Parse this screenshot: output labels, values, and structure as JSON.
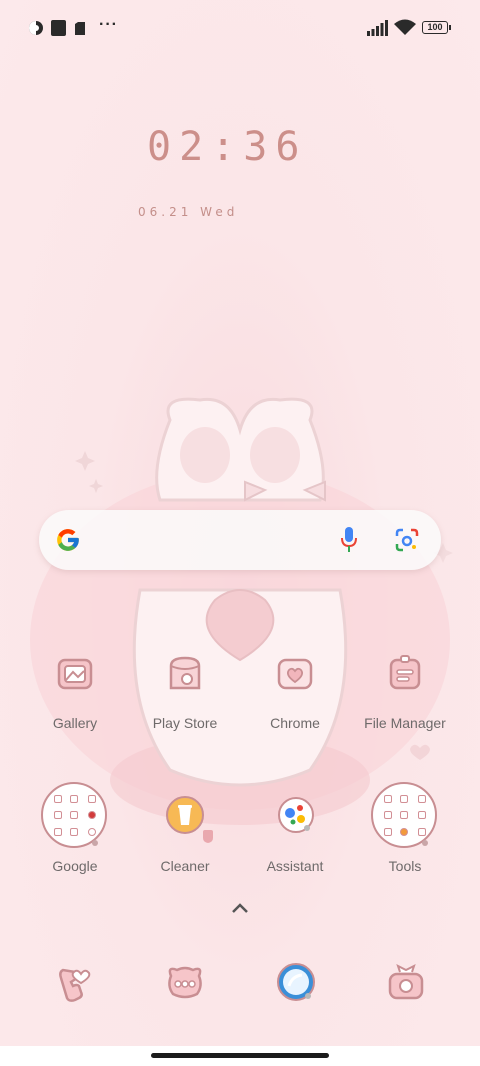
{
  "status_bar": {
    "battery": "100",
    "icons": [
      "theme-icon",
      "square-notification-icon",
      "sim-icon",
      "more-dots-icon",
      "signal-icon",
      "wifi-icon",
      "battery-icon"
    ],
    "more": "···"
  },
  "clock": {
    "time": "02:36",
    "date": "06.21 Wed"
  },
  "search": {
    "icons": [
      "google-g-icon",
      "mic-icon",
      "lens-icon"
    ]
  },
  "apps_row1": [
    {
      "label": "Gallery",
      "icon": "gallery-icon"
    },
    {
      "label": "Play Store",
      "icon": "play-store-icon"
    },
    {
      "label": "Chrome",
      "icon": "chrome-icon"
    },
    {
      "label": "File Manager",
      "icon": "file-manager-icon"
    }
  ],
  "apps_row2": [
    {
      "label": "Google",
      "icon": "google-folder-icon"
    },
    {
      "label": "Cleaner",
      "icon": "cleaner-icon"
    },
    {
      "label": "Assistant",
      "icon": "assistant-icon"
    },
    {
      "label": "Tools",
      "icon": "tools-folder-icon"
    }
  ],
  "drawer_arrow": "^",
  "dock": [
    {
      "icon": "phone-icon"
    },
    {
      "icon": "messages-icon"
    },
    {
      "icon": "browser-icon"
    },
    {
      "icon": "camera-icon"
    }
  ],
  "colors": {
    "background": "#fbe6e8",
    "accent": "#cc8f8a",
    "icon_outline": "#c88e92"
  }
}
